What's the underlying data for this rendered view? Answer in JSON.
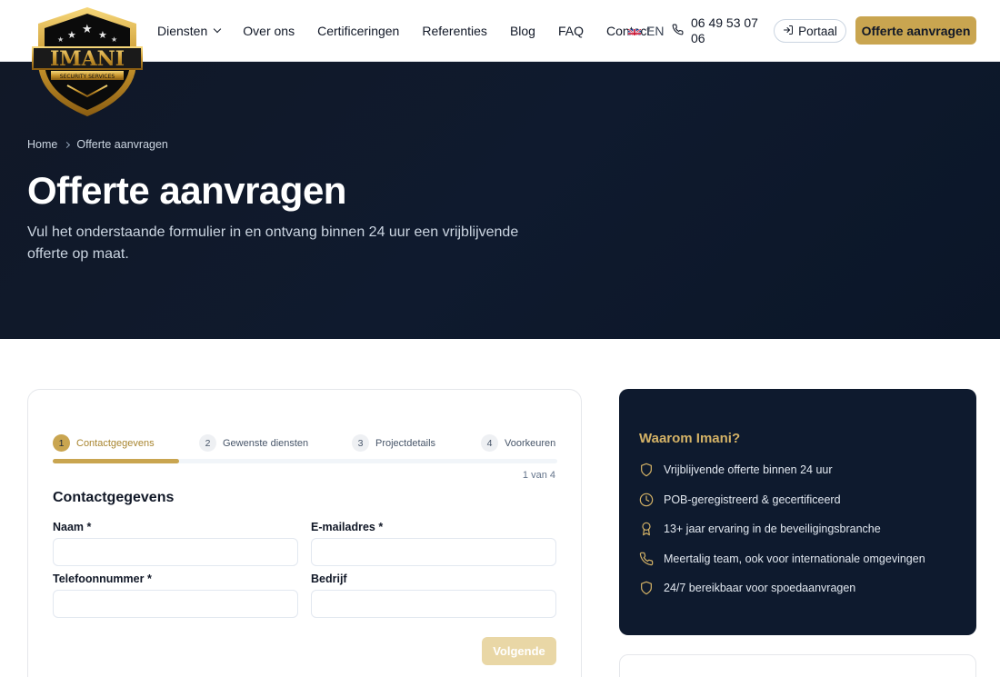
{
  "header": {
    "logo_alt": "IMANI Security Services",
    "nav": [
      {
        "label": "Diensten",
        "has_dropdown": true
      },
      {
        "label": "Over ons"
      },
      {
        "label": "Certificeringen"
      },
      {
        "label": "Referenties"
      },
      {
        "label": "Blog"
      },
      {
        "label": "FAQ"
      },
      {
        "label": "Contact"
      }
    ],
    "language": "EN",
    "phone": "06 49 53 07 06",
    "portal_label": "Portaal",
    "cta_label": "Offerte aanvragen"
  },
  "hero": {
    "breadcrumb": [
      "Home",
      "Offerte aanvragen"
    ],
    "title": "Offerte aanvragen",
    "subtitle": "Vul het onderstaande formulier in en ontvang binnen 24 uur een vrijblijvende offerte op maat."
  },
  "form": {
    "steps": [
      {
        "num": "1",
        "label": "Contactgegevens",
        "active": true
      },
      {
        "num": "2",
        "label": "Gewenste diensten"
      },
      {
        "num": "3",
        "label": "Projectdetails"
      },
      {
        "num": "4",
        "label": "Voorkeuren"
      }
    ],
    "progress": 0.25,
    "step_count": "1 van 4",
    "section_title": "Contactgegevens",
    "fields": {
      "naam": {
        "label": "Naam *",
        "value": ""
      },
      "email": {
        "label": "E-mailadres *",
        "value": ""
      },
      "telefoon": {
        "label": "Telefoonnummer *",
        "value": ""
      },
      "bedrijf": {
        "label": "Bedrijf",
        "value": ""
      }
    },
    "next_label": "Volgende"
  },
  "why": {
    "title": "Waarom Imani?",
    "items": [
      {
        "icon": "shield-icon",
        "text": "Vrijblijvende offerte binnen 24 uur"
      },
      {
        "icon": "clock-icon",
        "text": "POB-geregistreerd & gecertificeerd"
      },
      {
        "icon": "award-icon",
        "text": "13+ jaar ervaring in de beveiligingsbranche"
      },
      {
        "icon": "phone-icon",
        "text": "Meertalig team, ook voor internationale omgevingen"
      },
      {
        "icon": "shield-icon",
        "text": "24/7 bereikbaar voor spoedaanvragen"
      }
    ]
  },
  "colors": {
    "gold": "#c9a550",
    "navy": "#0e1a2e",
    "gold_light": "#e9d7a6"
  }
}
